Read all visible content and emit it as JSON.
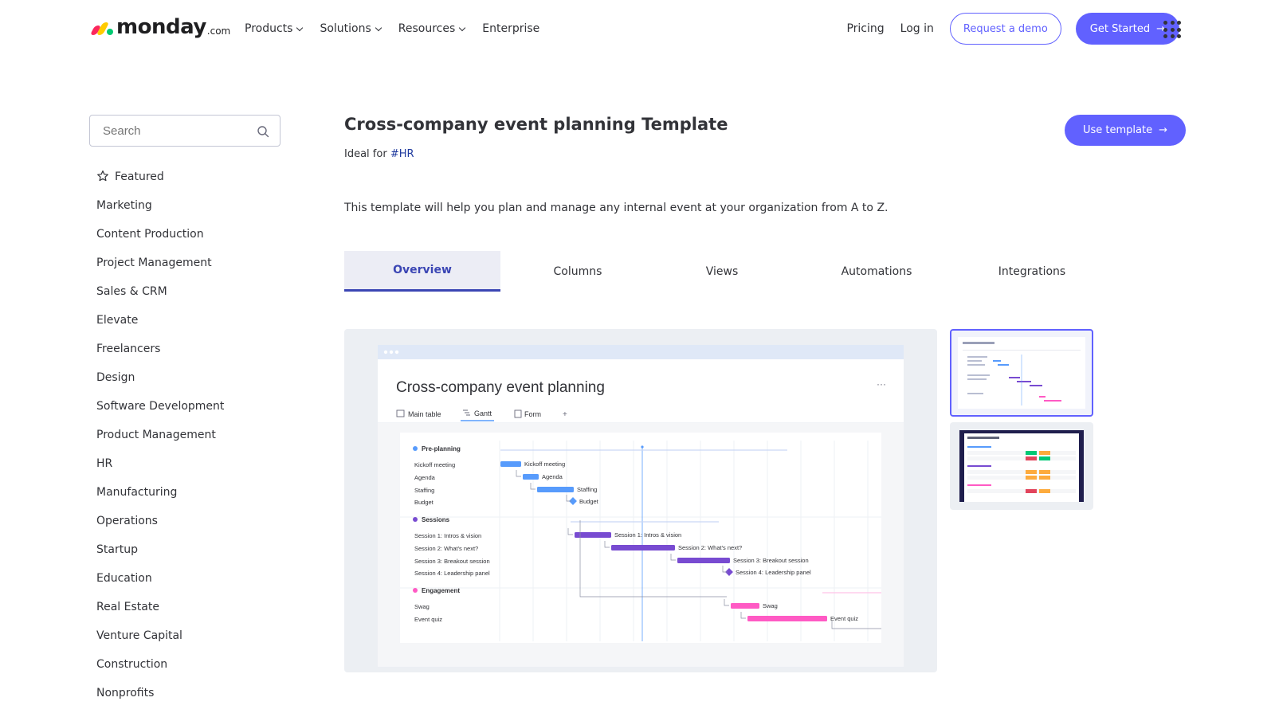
{
  "brand": {
    "word": "monday",
    "suffix": ".com"
  },
  "nav": {
    "menu": [
      {
        "label": "Products",
        "dropdown": true
      },
      {
        "label": "Solutions",
        "dropdown": true
      },
      {
        "label": "Resources",
        "dropdown": true
      },
      {
        "label": "Enterprise",
        "dropdown": false
      }
    ],
    "pricing": "Pricing",
    "login": "Log in",
    "demo": "Request a demo",
    "start": "Get Started"
  },
  "sidebar": {
    "search_placeholder": "Search",
    "featured": "Featured",
    "categories": [
      "Marketing",
      "Content Production",
      "Project Management",
      "Sales & CRM",
      "Elevate",
      "Freelancers",
      "Design",
      "Software Development",
      "Product Management",
      "HR",
      "Manufacturing",
      "Operations",
      "Startup",
      "Education",
      "Real Estate",
      "Venture Capital",
      "Construction",
      "Nonprofits"
    ]
  },
  "template": {
    "title": "Cross-company event planning Template",
    "ideal_prefix": "Ideal for",
    "ideal_tag": "#HR",
    "use_button": "Use template",
    "description": "This template will help you plan and manage any internal event at your organization from A to Z."
  },
  "tabs": [
    {
      "label": "Overview",
      "active": true
    },
    {
      "label": "Columns",
      "active": false
    },
    {
      "label": "Views",
      "active": false
    },
    {
      "label": "Automations",
      "active": false
    },
    {
      "label": "Integrations",
      "active": false
    }
  ],
  "preview": {
    "board_title": "Cross-company event planning",
    "views": [
      "Main table",
      "Gantt",
      "Form",
      "+"
    ],
    "active_view": "Gantt",
    "groups": [
      {
        "name": "Pre-planning",
        "color": "#579bfc",
        "items": [
          {
            "name": "Kickoff meeting",
            "bar_label": "Kickoff meeting",
            "milestone": false
          },
          {
            "name": "Agenda",
            "bar_label": "Agenda",
            "milestone": false
          },
          {
            "name": "Staffing",
            "bar_label": "Staffing",
            "milestone": false
          },
          {
            "name": "Budget",
            "bar_label": "Budget",
            "milestone": true
          }
        ]
      },
      {
        "name": "Sessions",
        "color": "#784bd1",
        "items": [
          {
            "name": "Session 1: Intros & vision",
            "bar_label": "Session 1: Intros & vision",
            "milestone": false
          },
          {
            "name": "Session 2: What's next?",
            "bar_label": "Session 2: What's next?",
            "milestone": false
          },
          {
            "name": "Session 3: Breakout session",
            "bar_label": "Session 3: Breakout session",
            "milestone": false
          },
          {
            "name": "Session 4: Leadership panel",
            "bar_label": "Session 4: Leadership panel",
            "milestone": true
          }
        ]
      },
      {
        "name": "Engagement",
        "color": "#ff5ac4",
        "items": [
          {
            "name": "Swag",
            "bar_label": "Swag",
            "milestone": false
          },
          {
            "name": "Event quiz",
            "bar_label": "Event quiz",
            "milestone": false
          }
        ]
      }
    ]
  },
  "colors": {
    "accent": "#6161ff",
    "tab_active": "#3b46b4",
    "text": "#323338"
  },
  "icons": {
    "search": "search-icon",
    "featured": "star-icon",
    "apps": "grid-icon",
    "arrow": "arrow-right-icon"
  }
}
